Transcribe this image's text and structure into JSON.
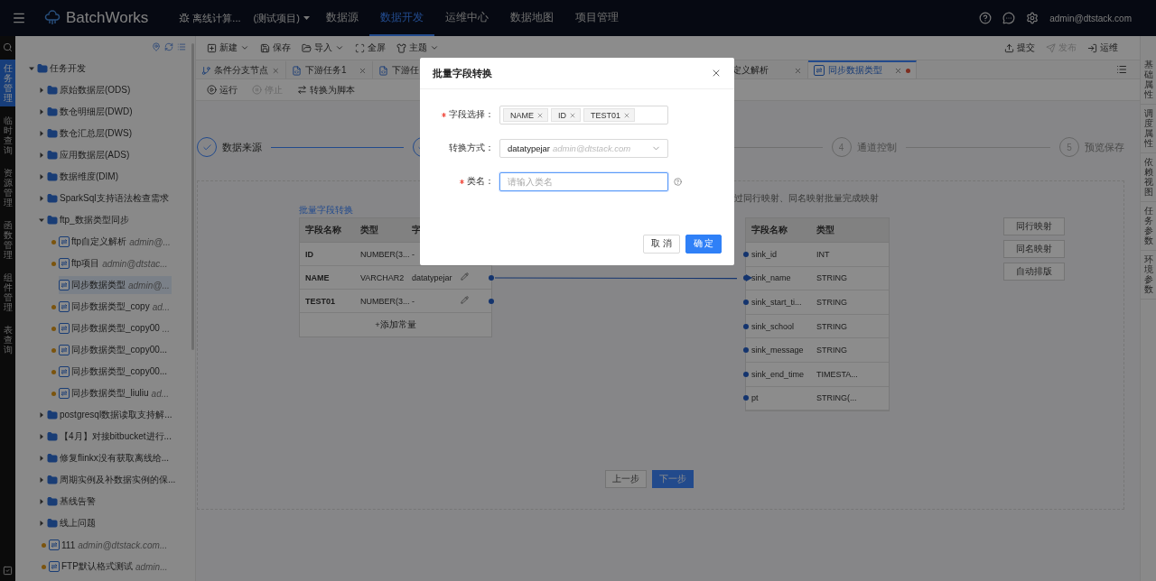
{
  "header": {
    "logo": "BatchWorks",
    "project": {
      "name": "离线计算...",
      "tag": "(测试项目)"
    },
    "nav": [
      {
        "label": "数据源",
        "selected": false
      },
      {
        "label": "数据开发",
        "selected": true
      },
      {
        "label": "运维中心",
        "selected": false
      },
      {
        "label": "数据地图",
        "selected": false
      },
      {
        "label": "项目管理",
        "selected": false
      }
    ],
    "user": "admin@dtstack.com"
  },
  "rail": [
    {
      "label": "任务管理",
      "selected": true
    },
    {
      "label": "临时查询",
      "selected": false
    },
    {
      "label": "资源管理",
      "selected": false
    },
    {
      "label": "函数管理",
      "selected": false
    },
    {
      "label": "组件管理",
      "selected": false
    },
    {
      "label": "表查询",
      "selected": false
    }
  ],
  "tree": [
    {
      "kind": "folder",
      "label": "任务开发",
      "expanded": true,
      "children": [
        {
          "kind": "folder",
          "label": "原始数据层(ODS)",
          "expanded": false
        },
        {
          "kind": "folder",
          "label": "数仓明细层(DWD)",
          "expanded": false
        },
        {
          "kind": "folder",
          "label": "数仓汇总层(DWS)",
          "expanded": false
        },
        {
          "kind": "folder",
          "label": "应用数据层(ADS)",
          "expanded": false
        },
        {
          "kind": "folder",
          "label": "数据维度(DIM)",
          "expanded": false
        },
        {
          "kind": "folder",
          "label": "SparkSql支持语法检查需求",
          "expanded": false
        },
        {
          "kind": "folder",
          "label": "ftp_数据类型同步",
          "expanded": true,
          "children": [
            {
              "kind": "task",
              "label": "ftp自定义解析",
              "owner": "admin@...",
              "locked": true,
              "selected": false
            },
            {
              "kind": "task",
              "label": "ftp项目",
              "owner": "admin@dtstac...",
              "locked": true,
              "selected": false
            },
            {
              "kind": "task",
              "label": "同步数据类型",
              "owner": "admin@...",
              "locked": false,
              "selected": true
            },
            {
              "kind": "task",
              "label": "同步数据类型_copy",
              "owner": "ad...",
              "locked": true,
              "selected": false
            },
            {
              "kind": "task",
              "label": "同步数据类型_copy00",
              "owner": "...",
              "locked": true,
              "selected": false
            },
            {
              "kind": "task",
              "label": "同步数据类型_copy00...",
              "locked": true,
              "selected": false
            },
            {
              "kind": "task",
              "label": "同步数据类型_copy00...",
              "locked": true,
              "selected": false
            },
            {
              "kind": "task",
              "label": "同步数据类型_liuliu",
              "owner": "ad...",
              "locked": true,
              "selected": false
            }
          ]
        },
        {
          "kind": "folder",
          "label": "postgresql数据读取支持解...",
          "expanded": false
        },
        {
          "kind": "folder",
          "label": "【4月】对接bitbucket进行...",
          "expanded": false
        },
        {
          "kind": "folder",
          "label": "修复flinkx没有获取离线给...",
          "expanded": false
        },
        {
          "kind": "folder",
          "label": "周期实例及补数据实例的保...",
          "expanded": false
        },
        {
          "kind": "folder",
          "label": "基线告警",
          "expanded": false
        },
        {
          "kind": "folder",
          "label": "线上问题",
          "expanded": false
        },
        {
          "kind": "task",
          "label": "111",
          "owner": "admin@dtstack.com...",
          "locked": true,
          "selected": false
        },
        {
          "kind": "task",
          "label": "FTP默认格式测试",
          "owner": "admin...",
          "locked": true,
          "selected": false
        }
      ]
    }
  ],
  "toolbar": {
    "left": [
      {
        "label": "新建",
        "dropdown": true
      },
      {
        "label": "保存",
        "dropdown": false
      },
      {
        "label": "导入",
        "dropdown": true
      },
      {
        "label": "全屏",
        "dropdown": false
      },
      {
        "label": "主题",
        "dropdown": true
      }
    ],
    "right": [
      {
        "label": "提交",
        "disabled": false
      },
      {
        "label": "发布",
        "disabled": true
      },
      {
        "label": "运维",
        "disabled": false
      }
    ]
  },
  "tabs": [
    {
      "label": "条件分支节点",
      "kind": "branch",
      "selected": false,
      "dirty": false
    },
    {
      "label": "下游任务1",
      "kind": "sql",
      "selected": false,
      "dirty": false
    },
    {
      "label": "下游任",
      "kind": "sql_cut",
      "selected": false,
      "dirty": false
    },
    {
      "label": "定义解析",
      "kind": "hidden",
      "selected": false,
      "dirty": false
    },
    {
      "label": "同步数据类型",
      "kind": "sync",
      "selected": true,
      "dirty": true
    }
  ],
  "actions": [
    {
      "label": "运行",
      "disabled": false
    },
    {
      "label": "停止",
      "disabled": true
    },
    {
      "label": "转换为脚本",
      "disabled": false
    }
  ],
  "steps": [
    {
      "done": true,
      "label": "数据来源"
    },
    {
      "done": true
    },
    {
      "done": false,
      "number": "4",
      "label": "通道控制"
    },
    {
      "done": false,
      "number": "5",
      "label": "预览保存"
    }
  ],
  "mapping": {
    "hint": "过同行映射、同名映射批量完成映射",
    "link": "批量字段转换",
    "source": {
      "columns": [
        "字段名称",
        "类型",
        "字"
      ],
      "rows": [
        {
          "name": "ID",
          "type": "NUMBER(3...",
          "convert": "-"
        },
        {
          "name": "NAME",
          "type": "VARCHAR2",
          "convert": "datatypejar",
          "edit": true,
          "endpoint": true,
          "mapped": true
        },
        {
          "name": "TEST01",
          "type": "NUMBER(3...",
          "convert": "-",
          "edit": true,
          "endpoint": true,
          "mapped": false
        }
      ],
      "add": "+添加常量"
    },
    "target": {
      "columns": [
        "字段名称",
        "类型"
      ],
      "rows": [
        {
          "name": "sink_id",
          "type": "INT",
          "mapped": false
        },
        {
          "name": "sink_name",
          "type": "STRING",
          "mapped": true
        },
        {
          "name": "sink_start_ti...",
          "type": "STRING",
          "mapped": false
        },
        {
          "name": "sink_school",
          "type": "STRING",
          "mapped": false
        },
        {
          "name": "sink_message",
          "type": "STRING",
          "mapped": false
        },
        {
          "name": "sink_end_time",
          "type": "TIMESTA...",
          "mapped": false
        },
        {
          "name": "pt",
          "type": "STRING(...",
          "mapped": false
        }
      ]
    },
    "buttons": [
      "同行映射",
      "同名映射",
      "自动排版"
    ]
  },
  "nav_buttons": [
    {
      "label": "上一步",
      "primary": false
    },
    {
      "label": "下一步",
      "primary": true
    }
  ],
  "right_rail": [
    "基础属性",
    "调度属性",
    "依赖视图",
    "任务参数",
    "环境参数"
  ],
  "modal": {
    "title": "批量字段转换",
    "fields": [
      {
        "kind": "tags",
        "label": "字段选择：",
        "required": true,
        "tags": [
          "NAME",
          "ID",
          "TEST01"
        ]
      },
      {
        "kind": "select",
        "label": "转换方式：",
        "required": false,
        "value": "datatypejar",
        "hint": "admin@dtstack.com"
      },
      {
        "kind": "input",
        "label": "类名：",
        "required": true,
        "placeholder": "请输入类名",
        "focused": true,
        "help": true
      }
    ],
    "buttons": [
      {
        "label": "取 消",
        "primary": false
      },
      {
        "label": "确 定",
        "primary": true
      }
    ]
  }
}
